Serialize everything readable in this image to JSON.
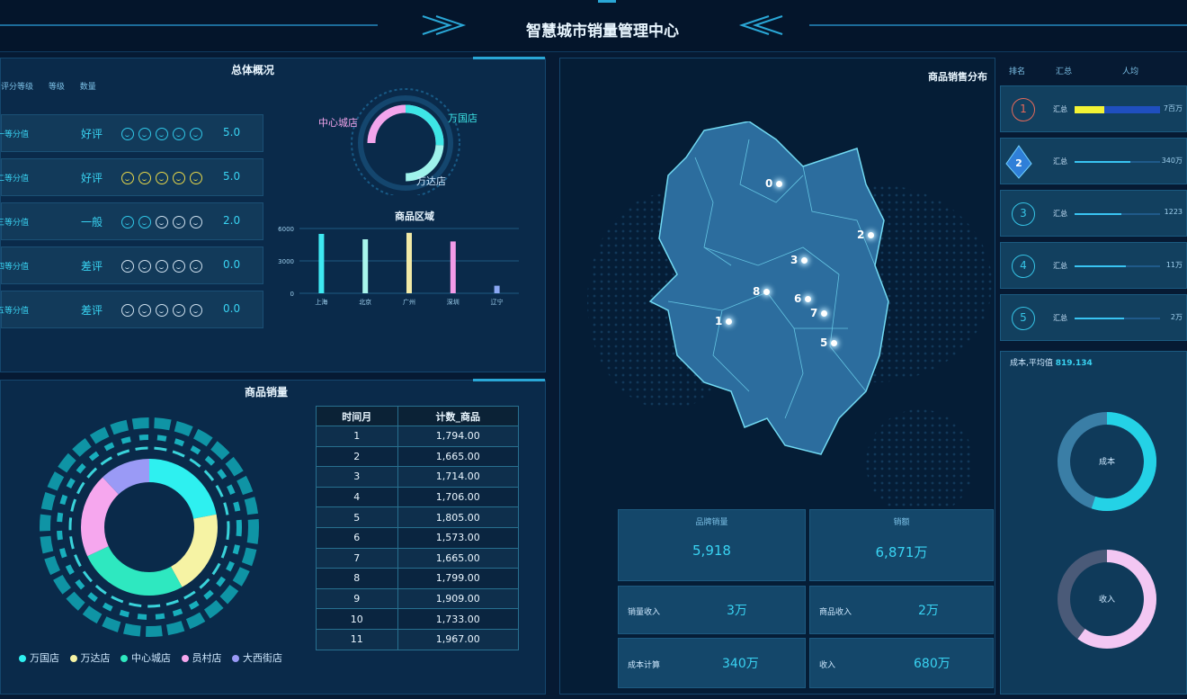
{
  "header": {
    "title": "智慧城市销量管理中心"
  },
  "overview": {
    "title": "总体概况",
    "columns": [
      "评分等级",
      "等级",
      "数量"
    ],
    "rows": [
      {
        "tier": "一等分值",
        "rating": "好评",
        "faces": "c",
        "score": "5.0"
      },
      {
        "tier": "二等分值",
        "rating": "好评",
        "faces": "y",
        "score": "5.0"
      },
      {
        "tier": "三等分值",
        "rating": "一般",
        "faces": "m",
        "score": "2.0"
      },
      {
        "tier": "四等分值",
        "rating": "差评",
        "faces": "w",
        "score": "0.0"
      },
      {
        "tier": "五等分值",
        "rating": "差评",
        "faces": "w",
        "score": "0.0"
      }
    ]
  },
  "store_ring": {
    "labels": [
      "中心城店",
      "万国店",
      "万达店"
    ]
  },
  "region_chart": {
    "chart_data": {
      "type": "bar",
      "title": "商品区域",
      "categories": [
        "上海",
        "北京",
        "广州",
        "深圳",
        "辽宁"
      ],
      "values": [
        5500,
        5000,
        5600,
        4800,
        700
      ],
      "colors": [
        "#3ee9f2",
        "#a9f6ec",
        "#f2eaa7",
        "#f29be8",
        "#8aa7f2"
      ],
      "yticks": [
        "0",
        "3000",
        "6000"
      ],
      "ylim": [
        0,
        6000
      ]
    }
  },
  "sales_volume": {
    "title": "商品销量",
    "donut": {
      "chart_data": {
        "type": "pie",
        "categories": [
          "万国店",
          "万达店",
          "中心城店",
          "员村店",
          "大西街店"
        ],
        "values": [
          22,
          20,
          26,
          20,
          12
        ],
        "colors": [
          "#2ef0f0",
          "#f6f3a4",
          "#2ee8c0",
          "#f6a7ee",
          "#9a9af6"
        ]
      }
    },
    "legend": [
      "万国店",
      "万达店",
      "中心城店",
      "员村店",
      "大西街店"
    ],
    "table": {
      "headers": [
        "时间月",
        "计数_商品"
      ],
      "rows": [
        [
          "1",
          "1,794.00"
        ],
        [
          "2",
          "1,665.00"
        ],
        [
          "3",
          "1,714.00"
        ],
        [
          "4",
          "1,706.00"
        ],
        [
          "5",
          "1,805.00"
        ],
        [
          "6",
          "1,573.00"
        ],
        [
          "7",
          "1,665.00"
        ],
        [
          "8",
          "1,799.00"
        ],
        [
          "9",
          "1,909.00"
        ],
        [
          "10",
          "1,733.00"
        ],
        [
          "11",
          "1,967.00"
        ]
      ]
    }
  },
  "map": {
    "title": "商品销售分布",
    "labels": [
      "0",
      "1",
      "2",
      "3",
      "5",
      "6",
      "7",
      "8"
    ]
  },
  "stats": {
    "brand_sales_label": "品牌销量",
    "brand_sales_value": "5,918",
    "revenue_label": "销额",
    "revenue_value": "6,871万",
    "sales_income_label": "销量收入",
    "sales_income_value": "3万",
    "goods_income_label": "商品收入",
    "goods_income_value": "2万",
    "cost_label": "成本计算",
    "cost_value": "340万",
    "income_label": "收入",
    "income_value": "680万"
  },
  "ranking": {
    "headers": [
      "排名",
      "汇总",
      "人均"
    ],
    "rows": [
      {
        "rank": "1",
        "label": "汇总",
        "value": "7百万",
        "fill": 0.9
      },
      {
        "rank": "2",
        "label": "汇总",
        "value": "340万",
        "fill": 0.65
      },
      {
        "rank": "3",
        "label": "汇总",
        "value": "1223",
        "fill": 0.55
      },
      {
        "rank": "4",
        "label": "汇总",
        "value": "11万",
        "fill": 0.6
      },
      {
        "rank": "5",
        "label": "汇总",
        "value": "2万",
        "fill": 0.58
      }
    ]
  },
  "cost_panel": {
    "avg_label": "成本,平均值",
    "avg_value": "819.134",
    "ring1_label": "成本",
    "ring1_fill": 0.55,
    "ring2_label": "收入",
    "ring2_fill": 0.6
  }
}
